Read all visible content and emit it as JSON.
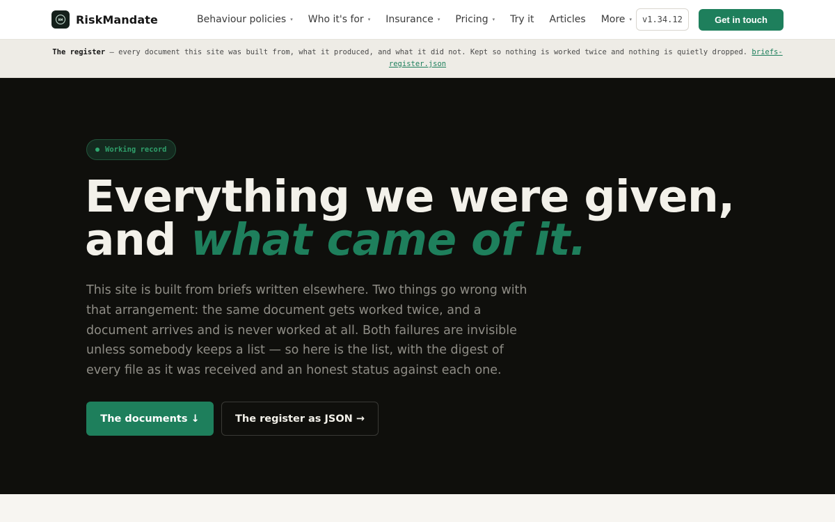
{
  "brand": {
    "name": "RiskMandate",
    "logo_mark": "RM"
  },
  "nav": {
    "items": [
      {
        "label": "Behaviour policies",
        "has_dropdown": true
      },
      {
        "label": "Who it's for",
        "has_dropdown": true
      },
      {
        "label": "Insurance",
        "has_dropdown": true
      },
      {
        "label": "Pricing",
        "has_dropdown": true
      },
      {
        "label": "Try it",
        "has_dropdown": false
      },
      {
        "label": "Articles",
        "has_dropdown": false
      },
      {
        "label": "More",
        "has_dropdown": true
      }
    ],
    "caret": "▾",
    "version": "v1.34.12",
    "cta_label": "Get in touch"
  },
  "banner": {
    "title": "The register",
    "text": " — every document this site was built from, what it produced, and what it did not. Kept so nothing is worked twice and nothing is quietly dropped. ",
    "link_label": "briefs-register.json"
  },
  "hero": {
    "badge": "Working record",
    "headline_line1": "Everything we were given,",
    "headline_and": "and ",
    "headline_accent": "what came of it.",
    "lede": "This site is built from briefs written elsewhere. Two things go wrong with that arrangement: the same document gets worked twice, and a document arrives and is never worked at all. Both failures are invisible unless somebody keeps a list — so here is the list, with the digest of every file as it was received and an honest status against each one.",
    "primary_button": "The documents ↓",
    "secondary_button": "The register as JSON →"
  },
  "colors": {
    "accent": "#1e7f5c",
    "hero_bg": "#0f0f0c",
    "banner_bg": "#eeece6",
    "page_bg": "#f7f5f1"
  }
}
